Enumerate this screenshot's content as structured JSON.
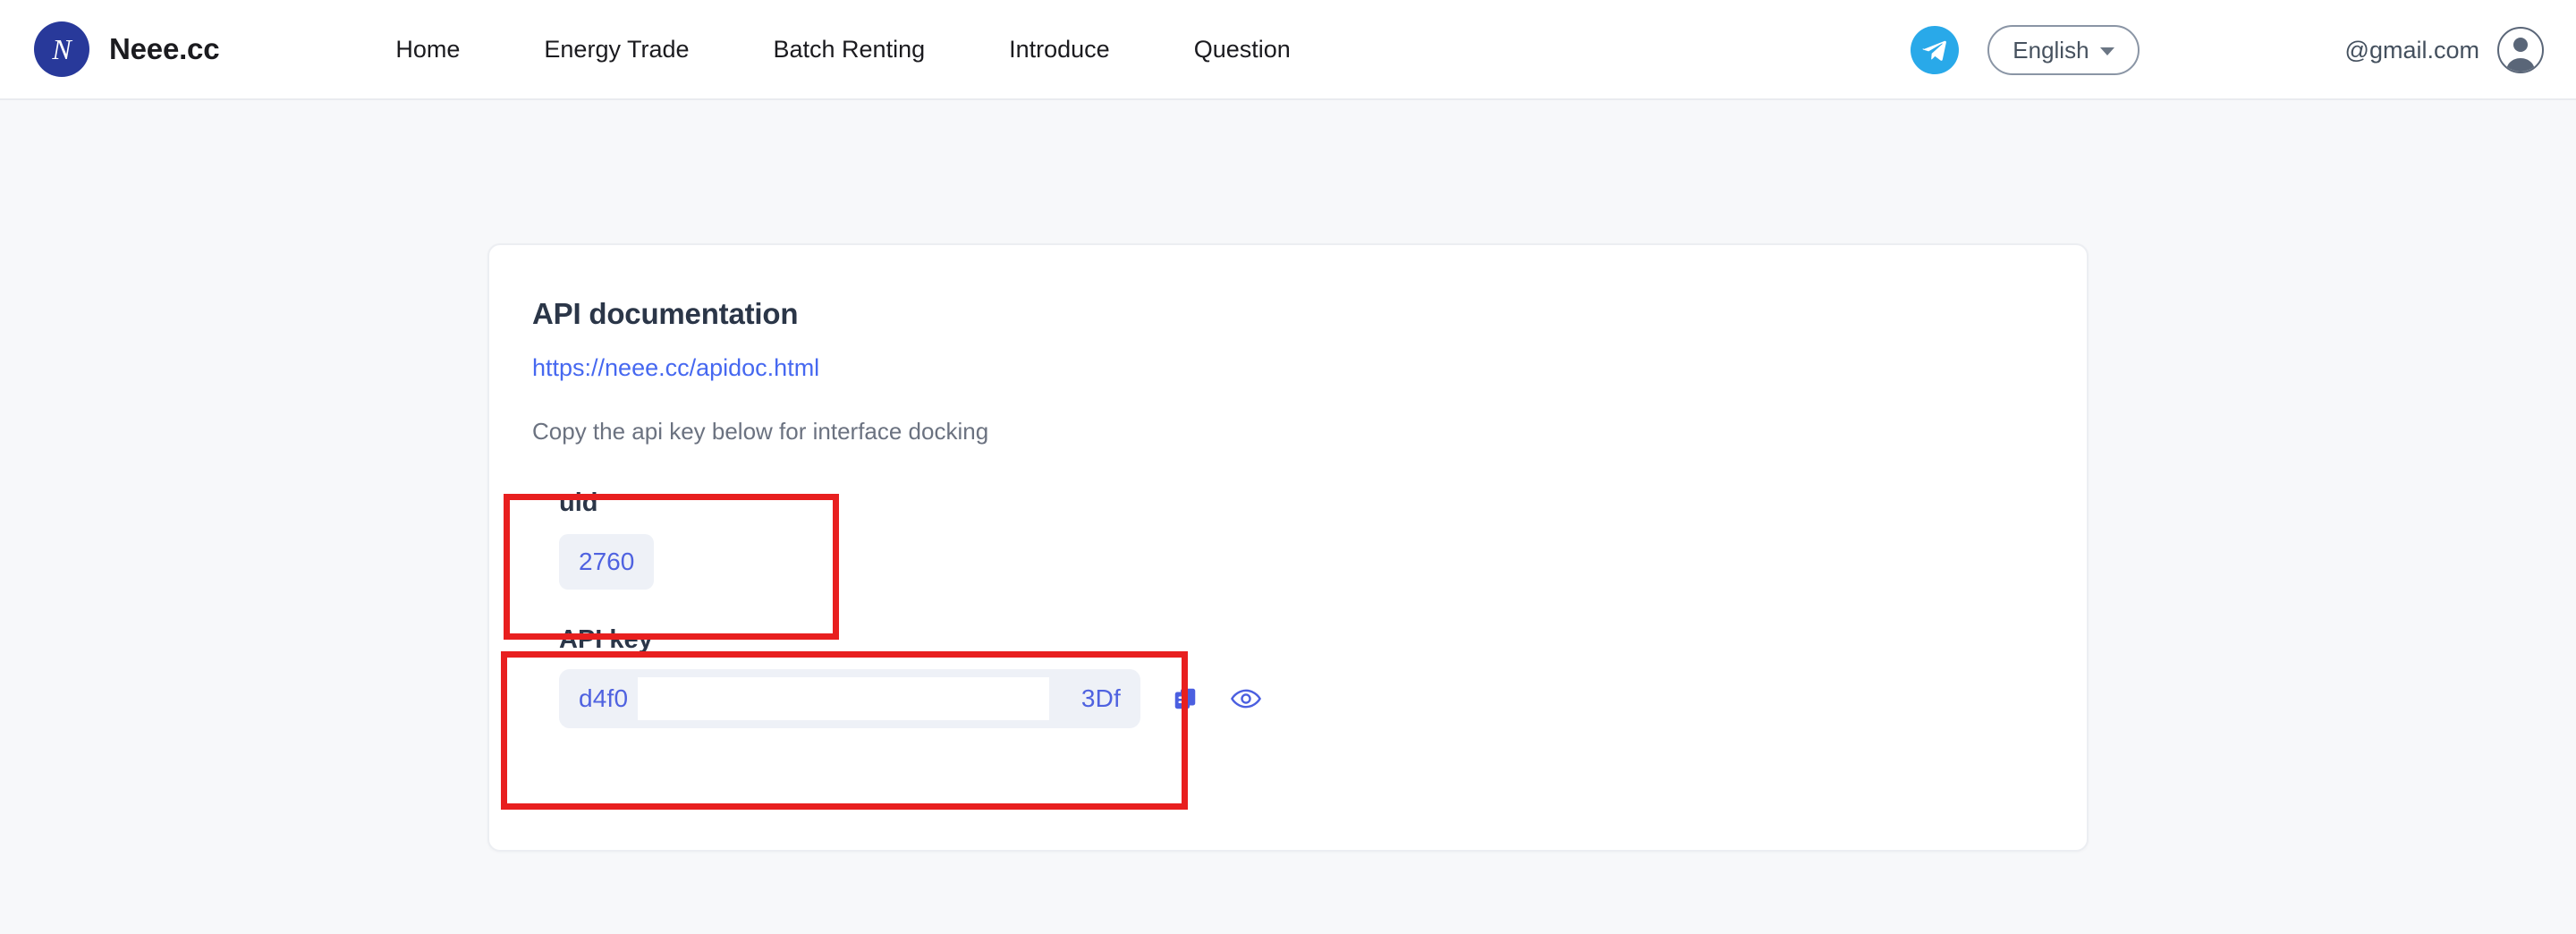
{
  "header": {
    "brand": {
      "name": "Neee.cc",
      "logo_icon": "letter-n-logo-icon",
      "logo_letter": "N"
    },
    "nav": [
      {
        "label": "Home",
        "name": "home"
      },
      {
        "label": "Energy Trade",
        "name": "energy-trade"
      },
      {
        "label": "Batch Renting",
        "name": "batch-renting"
      },
      {
        "label": "Introduce",
        "name": "introduce"
      },
      {
        "label": "Question",
        "name": "question"
      }
    ],
    "telegram_icon": "telegram-icon",
    "language": {
      "selected": "English",
      "chevron_icon": "chevron-down-icon"
    },
    "user": {
      "email": "@gmail.com",
      "avatar_icon": "user-avatar-icon"
    }
  },
  "card": {
    "title": "API documentation",
    "doc_link": "https://neee.cc/apidoc.html",
    "hint": "Copy the api key below for interface docking",
    "uid": {
      "label": "uid",
      "value": "2760"
    },
    "api_key": {
      "label": "API key",
      "value_prefix": "d4f0",
      "value_suffix": "3Df",
      "copy_icon": "copy-icon",
      "reveal_icon": "eye-icon"
    }
  },
  "annotations": {
    "uid_box": "red-highlight-box",
    "apikey_box": "red-highlight-box",
    "color": "#e81f1f"
  },
  "colors": {
    "brand_blue": "#28399a",
    "link_blue": "#4668f0",
    "value_blue": "#4f62e0",
    "telegram_blue": "#29a9e9",
    "page_bg": "#f7f8fa",
    "pill_bg": "#eef1f7"
  }
}
